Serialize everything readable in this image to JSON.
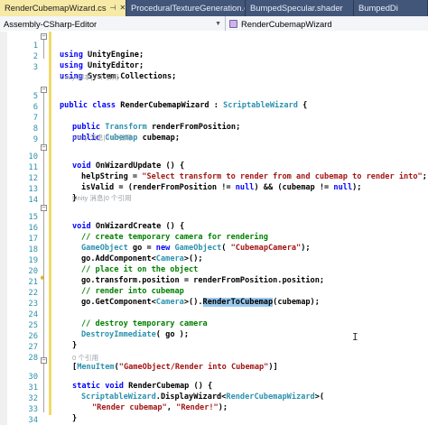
{
  "tabs": [
    {
      "label": "RenderCubemapWizard.cs",
      "active": true
    },
    {
      "label": "ProceduralTextureGeneration.cs",
      "active": false
    },
    {
      "label": "BumpedSpecular.shader",
      "active": false
    },
    {
      "label": "BumpedDi",
      "active": false
    }
  ],
  "nav": {
    "project": "Assembly-CSharp-Editor",
    "member": "RenderCubemapWizard"
  },
  "colors": {
    "keyword": "#0000ff",
    "type": "#2b91af",
    "string": "#a31515",
    "comment": "#008000",
    "line_number": "#2b91af",
    "highlight": "#99c9ef"
  },
  "code": {
    "l1": "using UnityEngine;",
    "l2": "using UnityEditor;",
    "l3": "using System.Collections;",
    "ref1": "Unity 脚本|1 个引用",
    "l5_kw": "public class",
    "l5_name": " RenderCubemapWizard : ",
    "l5_base": "ScriptableWizard",
    "l5_end": " {",
    "l7_kw": "public",
    "l7_type": " Transform",
    "l7_rest": " renderFromPosition;",
    "l8_kw": "public",
    "l8_type": " Cubemap",
    "l8_rest": " cubemap;",
    "ref2": "Unity 消息|0 个引用",
    "l10_kw": "void",
    "l10_rest": " OnWizardUpdate () {",
    "l11_a": "helpString = ",
    "l11_str": "\"Select transform to render from and cubemap to render into\"",
    "l11_b": ";",
    "l12_a": "isValid = (renderFromPosition != ",
    "l12_null1": "null",
    "l12_b": ") && (cubemap != ",
    "l12_null2": "null",
    "l12_c": ");",
    "l13": "}",
    "ref3": "Unity 消息|0 个引用",
    "l15_kw": "void",
    "l15_rest": " OnWizardCreate () {",
    "l16": "// create temporary camera for rendering",
    "l17_type": "GameObject",
    "l17_a": " go = ",
    "l17_new": "new",
    "l17_type2": " GameObject",
    "l17_b": "( ",
    "l17_str": "\"CubemapCamera\"",
    "l17_c": ");",
    "l18_a": "go.AddComponent<",
    "l18_type": "Camera",
    "l18_b": ">();",
    "l19": "// place it on the object",
    "l20": "go.transform.position = renderFromPosition.position;",
    "l21": "// render into cubemap",
    "l22_a": "go.GetComponent<",
    "l22_type": "Camera",
    "l22_b": ">().",
    "l22_hl": "RenderToCubemap",
    "l22_c": "(cubemap);",
    "l24": "// destroy temporary camera",
    "l25_a": "DestroyImmediate",
    "l25_b": "( go );",
    "l26": "}",
    "l28_a": "[",
    "l28_type": "MenuItem",
    "l28_b": "(",
    "l28_str": "\"GameObject/Render into Cubemap\"",
    "l28_c": ")]",
    "ref4": "0 个引用",
    "l30_kw": "static void",
    "l30_rest": " RenderCubemap () {",
    "l31_type": "ScriptableWizard",
    "l31_a": ".DisplayWizard<",
    "l31_type2": "RenderCubemapWizard",
    "l31_b": ">(",
    "l32_str1": "\"Render cubemap\"",
    "l32_a": ", ",
    "l32_str2": "\"Render!\"",
    "l32_b": ");",
    "l33": "}",
    "l34": "}"
  },
  "line_numbers": [
    "1",
    "2",
    "3",
    "5",
    "6",
    "7",
    "8",
    "9",
    "10",
    "11",
    "12",
    "13",
    "14",
    "15",
    "16",
    "17",
    "18",
    "19",
    "20",
    "21",
    "22",
    "23",
    "24",
    "25",
    "26",
    "27",
    "28",
    "29",
    "30",
    "31",
    "32",
    "33"
  ]
}
